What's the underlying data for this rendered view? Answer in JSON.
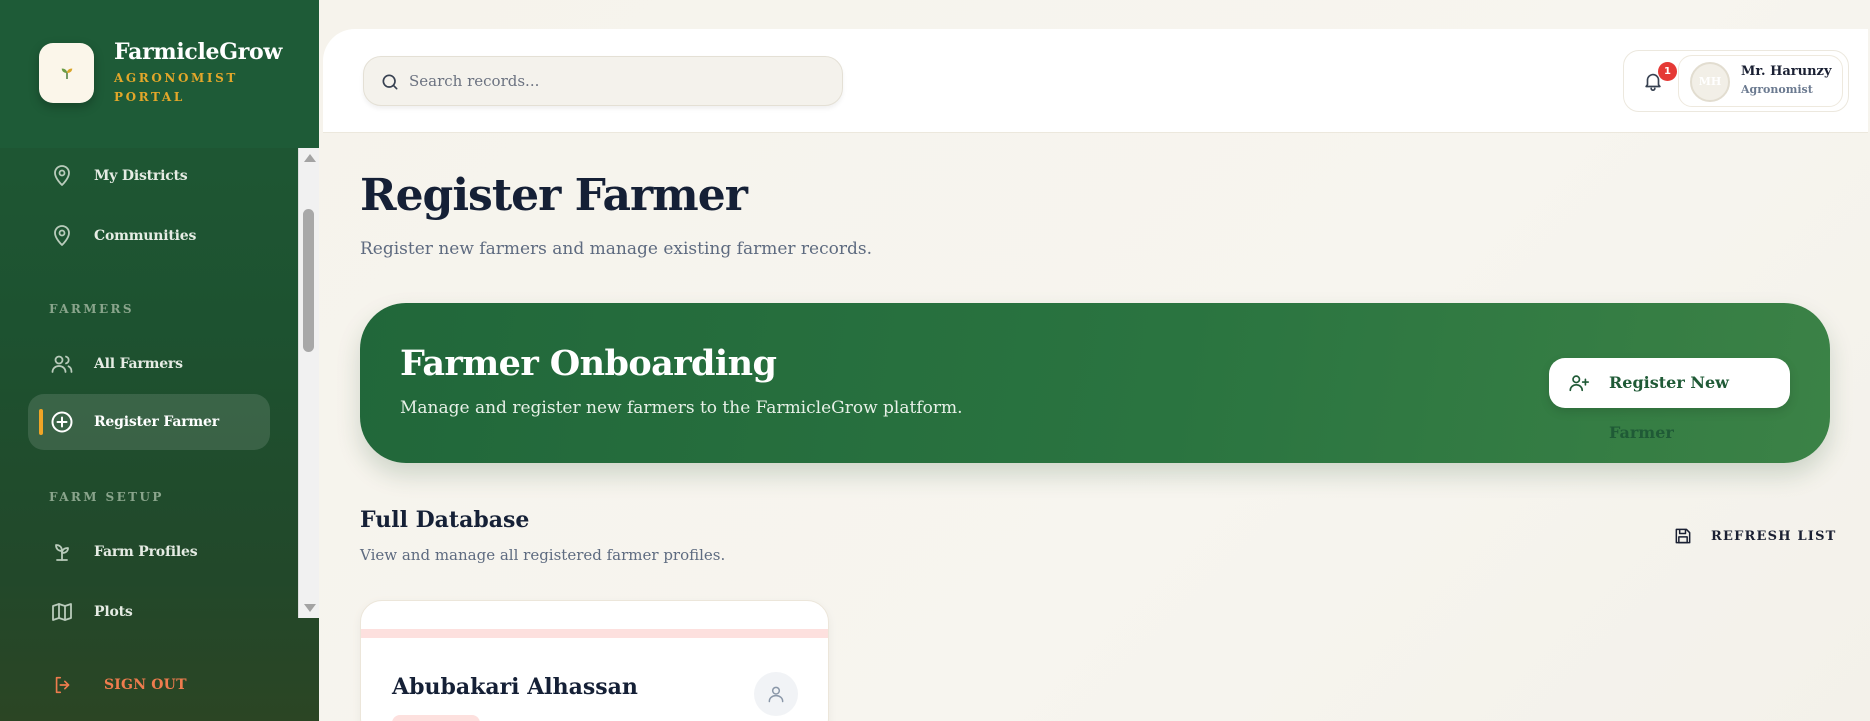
{
  "sidebar": {
    "brand_name": "FarmicleGrow",
    "brand_sub": "AGRONOMIST PORTAL",
    "items": [
      {
        "label": "My Districts",
        "icon": "map-pin-icon"
      },
      {
        "label": "Communities",
        "icon": "map-pin-icon"
      },
      {
        "label": "All Farmers",
        "icon": "users-icon"
      },
      {
        "label": "Register Farmer",
        "icon": "plus-circle-icon",
        "active": true
      },
      {
        "label": "Farm Profiles",
        "icon": "sprout-icon"
      },
      {
        "label": "Plots",
        "icon": "map-icon"
      }
    ],
    "sections": {
      "farmers": "FARMERS",
      "farm_setup": "FARM SETUP"
    },
    "sign_out": "SIGN OUT"
  },
  "header": {
    "search_placeholder": "Search records...",
    "notification_count": "1",
    "user": {
      "initials": "MH",
      "name": "Mr. Harunzy",
      "role": "Agronomist"
    }
  },
  "main": {
    "title": "Register Farmer",
    "subtitle": "Register new farmers and manage existing farmer records.",
    "hero": {
      "title": "Farmer Onboarding",
      "subtitle": "Manage and register new farmers to the FarmicleGrow platform.",
      "button": "Register New Farmer"
    },
    "database": {
      "title": "Full Database",
      "subtitle": "View and manage all registered farmer profiles.",
      "refresh": "REFRESH LIST"
    },
    "cards": [
      {
        "name": "Abubakari Alhassan"
      }
    ]
  },
  "colors": {
    "brand_green": "#1f5a36",
    "accent_gold": "#e3a72a",
    "sign_out": "#ee7c4e",
    "badge": "#e53935"
  }
}
